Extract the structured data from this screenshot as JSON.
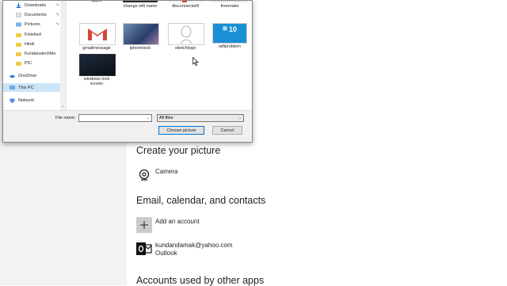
{
  "dialog": {
    "nav": [
      {
        "label": "Downloads",
        "icon": "download-icon"
      },
      {
        "label": "Documents",
        "icon": "document-icon"
      },
      {
        "label": "Pictures",
        "icon": "pictures-icon"
      },
      {
        "label": "Finished",
        "icon": "folder-icon"
      },
      {
        "label": "Hindi",
        "icon": "folder-icon"
      },
      {
        "label": "Kundanstechblo",
        "icon": "folder-icon"
      },
      {
        "label": "PIC",
        "icon": "folder-icon"
      },
      {
        "label": "OneDrive",
        "icon": "cloud-icon"
      },
      {
        "label": "This PC",
        "icon": "computer-icon"
      },
      {
        "label": "Network",
        "icon": "network-icon"
      }
    ],
    "files_top_row": [
      "apple",
      "change wifi name",
      "disconnectwifi",
      "freemake"
    ],
    "files": [
      "gmailmessage",
      "iphonelock",
      "sketchlogo",
      "wifiproblem",
      "windows lock screen"
    ],
    "file_name_label": "File name:",
    "file_name_value": "",
    "filter_value": "All files",
    "choose_button": "Choose picture",
    "cancel_button": "Cancel",
    "win10_text": "10"
  },
  "settings": {
    "create_title": "Create your picture",
    "camera_label": "Camera",
    "email_title": "Email, calendar, and contacts",
    "add_account_label": "Add an account",
    "account_email": "kundandamak@yahoo.com",
    "account_service": "Outlook",
    "other_apps_title": "Accounts used by other apps"
  }
}
